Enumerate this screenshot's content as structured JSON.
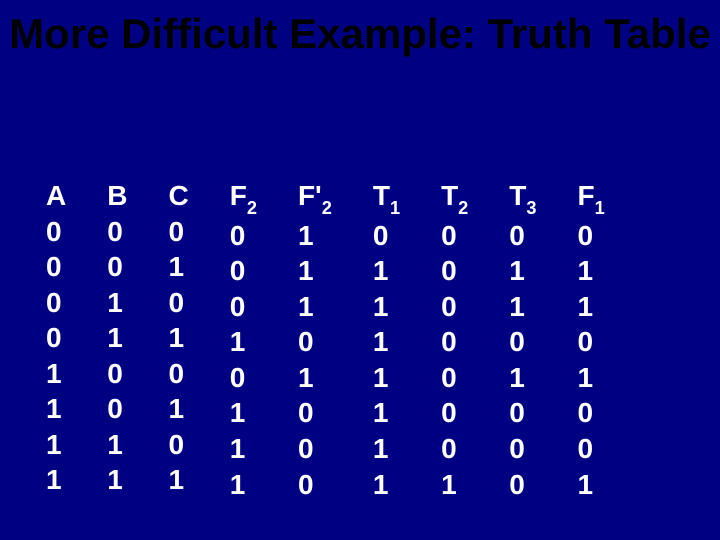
{
  "title": "More Difficult Example: Truth Table",
  "columns": [
    {
      "label": "A",
      "sub": "",
      "values": [
        "0",
        "0",
        "0",
        "0",
        "1",
        "1",
        "1",
        "1"
      ]
    },
    {
      "label": "B",
      "sub": "",
      "values": [
        "0",
        "0",
        "1",
        "1",
        "0",
        "0",
        "1",
        "1"
      ]
    },
    {
      "label": "C",
      "sub": "",
      "values": [
        "0",
        "1",
        "0",
        "1",
        "0",
        "1",
        "0",
        "1"
      ]
    },
    {
      "label": "F",
      "sub": "2",
      "values": [
        "0",
        "0",
        "0",
        "1",
        "0",
        "1",
        "1",
        "1"
      ]
    },
    {
      "label": "F'",
      "sub": "2",
      "values": [
        "1",
        "1",
        "1",
        "0",
        "1",
        "0",
        "0",
        "0"
      ]
    },
    {
      "label": "T",
      "sub": "1",
      "values": [
        "0",
        "1",
        "1",
        "1",
        "1",
        "1",
        "1",
        "1"
      ]
    },
    {
      "label": "T",
      "sub": "2",
      "values": [
        "0",
        "0",
        "0",
        "0",
        "0",
        "0",
        "0",
        "1"
      ]
    },
    {
      "label": "T",
      "sub": "3",
      "values": [
        "0",
        "1",
        "1",
        "0",
        "1",
        "0",
        "0",
        "0"
      ]
    },
    {
      "label": "F",
      "sub": "1",
      "values": [
        "0",
        "1",
        "1",
        "0",
        "1",
        "0",
        "0",
        "1"
      ]
    }
  ],
  "chart_data": {
    "type": "table",
    "title": "More Difficult Example: Truth Table",
    "columns": [
      "A",
      "B",
      "C",
      "F2",
      "F'2",
      "T1",
      "T2",
      "T3",
      "F1"
    ],
    "rows": [
      [
        0,
        0,
        0,
        0,
        1,
        0,
        0,
        0,
        0
      ],
      [
        0,
        0,
        1,
        0,
        1,
        1,
        0,
        1,
        1
      ],
      [
        0,
        1,
        0,
        0,
        1,
        1,
        0,
        1,
        1
      ],
      [
        0,
        1,
        1,
        1,
        0,
        1,
        0,
        0,
        0
      ],
      [
        1,
        0,
        0,
        0,
        1,
        1,
        0,
        1,
        1
      ],
      [
        1,
        0,
        1,
        1,
        0,
        1,
        0,
        0,
        0
      ],
      [
        1,
        1,
        0,
        1,
        0,
        1,
        0,
        0,
        0
      ],
      [
        1,
        1,
        1,
        1,
        0,
        1,
        1,
        0,
        1
      ]
    ]
  }
}
